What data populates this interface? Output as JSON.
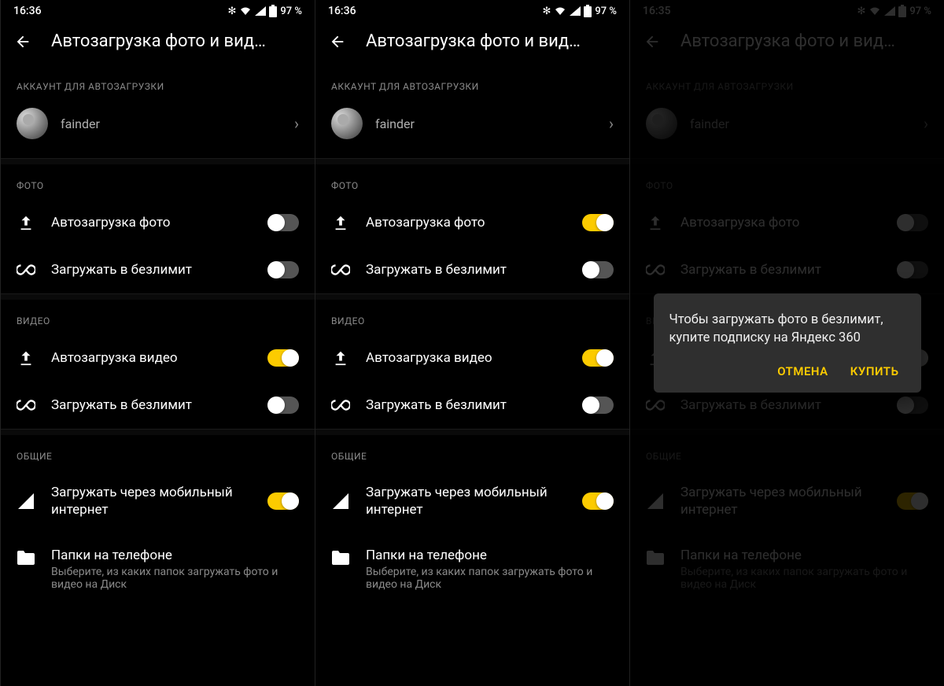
{
  "screens": [
    {
      "time": "16:36",
      "battery": "97 %",
      "photo_upload_on": false
    },
    {
      "time": "16:36",
      "battery": "97 %",
      "photo_upload_on": true
    },
    {
      "time": "16:35",
      "battery": "97 %",
      "dimmed": true,
      "dialog": true
    }
  ],
  "header_title": "Автозагрузка фото и вид…",
  "account_section": "АККАУНТ ДЛЯ АВТОЗАГРУЗКИ",
  "account_name": "fainder",
  "photo_section": "ФОТО",
  "photo_upload": "Автозагрузка фото",
  "photo_unlimited": "Загружать в безлимит",
  "video_section": "ВИДЕО",
  "video_upload": "Автозагрузка видео",
  "video_unlimited": "Загружать в безлимит",
  "general_section": "ОБЩИЕ",
  "mobile_internet": "Загружать через мобильный интернет",
  "folders_title": "Папки на телефоне",
  "folders_sub": "Выберите, из каких папок загружать фото и видео на Диск",
  "dialog_text": "Чтобы загружать фото в безлимит, купите подписку на Яндекс 360",
  "dialog_cancel": "ОТМЕНА",
  "dialog_buy": "КУПИТЬ"
}
